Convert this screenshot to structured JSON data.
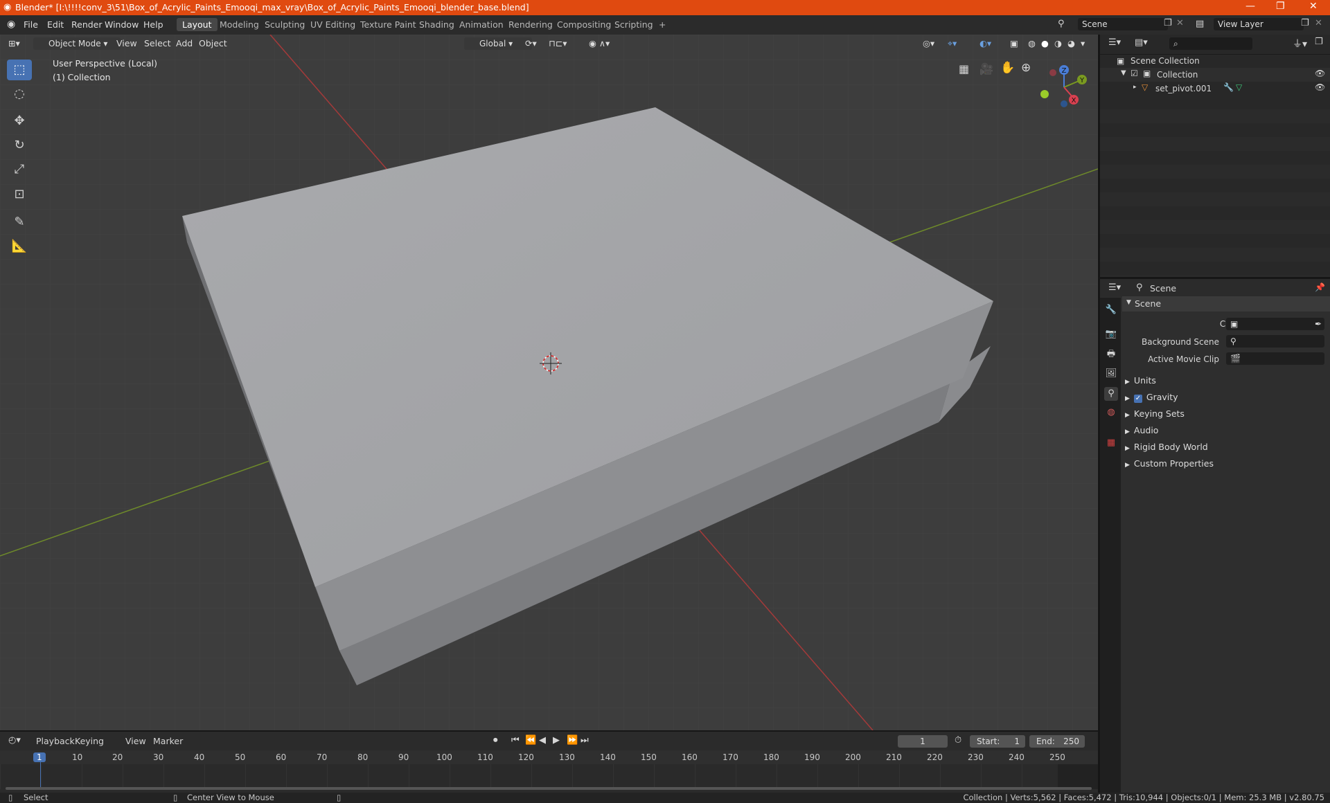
{
  "window": {
    "title": "Blender* [I:\\!!!!conv_3\\51\\Box_of_Acrylic_Paints_Emooqi_max_vray\\Box_of_Acrylic_Paints_Emooqi_blender_base.blend]",
    "accent": "#e04a10"
  },
  "menu": [
    "File",
    "Edit",
    "Render",
    "Window",
    "Help"
  ],
  "workspaces": [
    "Layout",
    "Modeling",
    "Sculpting",
    "UV Editing",
    "Texture Paint",
    "Shading",
    "Animation",
    "Rendering",
    "Compositing",
    "Scripting"
  ],
  "workspace_add": "+",
  "scene_field": "Scene",
  "view_layer_field": "View Layer",
  "viewport": {
    "mode": "Object Mode",
    "menus": [
      "View",
      "Select",
      "Add",
      "Object"
    ],
    "orientation": "Global",
    "overlay_title": "User Perspective (Local)",
    "overlay_collection": "(1) Collection",
    "gizmo": {
      "x": "X",
      "y": "Y",
      "z": "Z"
    }
  },
  "outliner": {
    "root": "Scene Collection",
    "collection": "Collection",
    "object": "set_pivot.001"
  },
  "properties": {
    "header": "Scene",
    "panel": "Scene",
    "fields": [
      {
        "label": "Camera"
      },
      {
        "label": "Background Scene"
      },
      {
        "label": "Active Movie Clip"
      }
    ],
    "sections": [
      "Units",
      "Gravity",
      "Keying Sets",
      "Audio",
      "Rigid Body World",
      "Custom Properties"
    ]
  },
  "timeline": {
    "menus": [
      "Playback",
      "Keying",
      "View",
      "Marker"
    ],
    "current_frame": "1",
    "start_label": "Start:",
    "start": "1",
    "end_label": "End:",
    "end": "250",
    "ticks": [
      "1",
      "10",
      "20",
      "30",
      "40",
      "50",
      "60",
      "70",
      "80",
      "90",
      "100",
      "110",
      "120",
      "130",
      "140",
      "150",
      "160",
      "170",
      "180",
      "190",
      "200",
      "210",
      "220",
      "230",
      "240",
      "250"
    ]
  },
  "status": {
    "left1": "Select",
    "left2": "Center View to Mouse",
    "right": "Collection | Verts:5,562 | Faces:5,472 | Tris:10,944 | Objects:0/1 | Mem: 25.3 MB | v2.80.75"
  }
}
